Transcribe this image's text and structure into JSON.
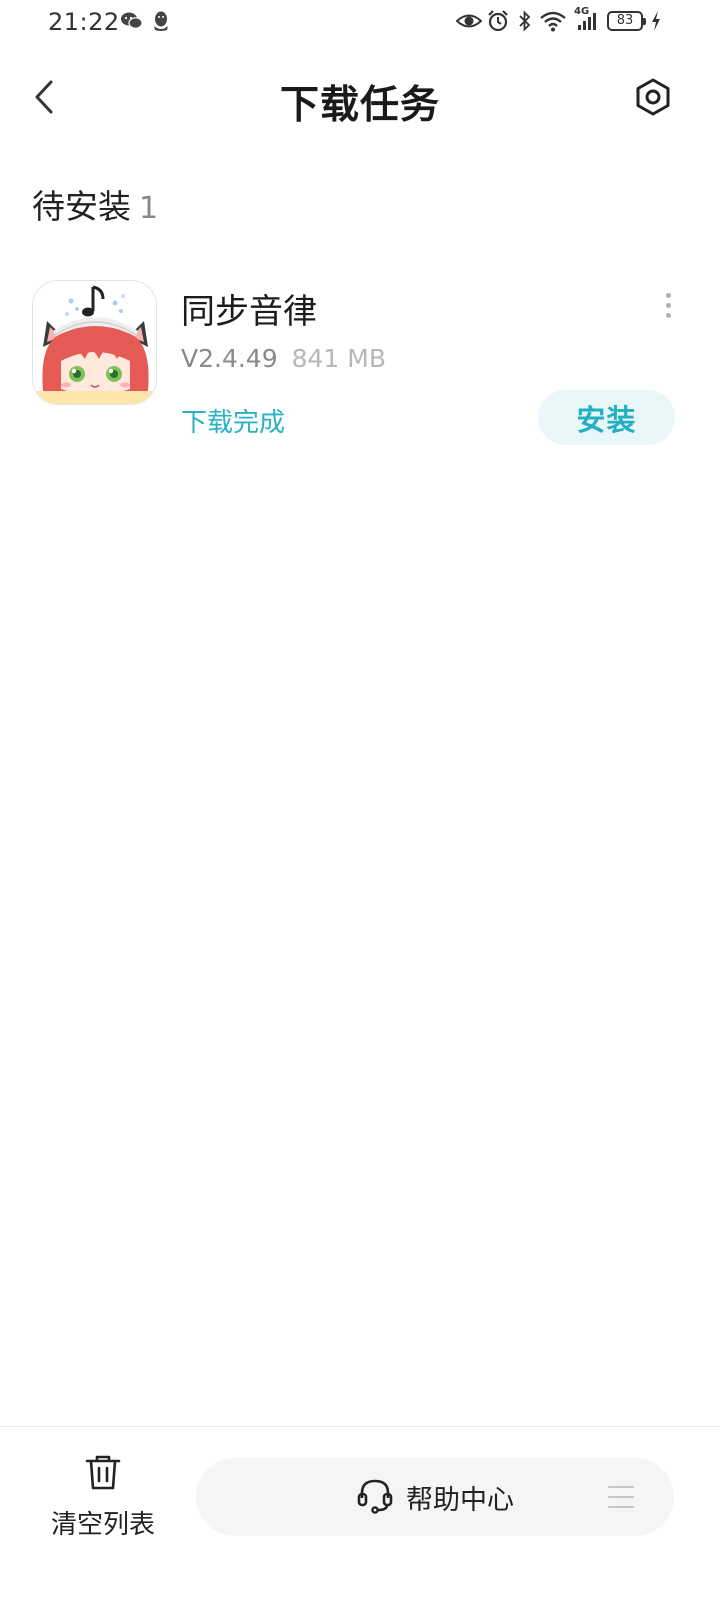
{
  "status_bar": {
    "time": "21:22",
    "network": "4G",
    "battery": "83"
  },
  "header": {
    "title": "下载任务"
  },
  "section": {
    "title": "待安装",
    "count": "1"
  },
  "task": {
    "app_name": "同步音律",
    "version": "V2.4.49",
    "size": "841 MB",
    "status": "下载完成",
    "install_label": "安装"
  },
  "bottom": {
    "clear_label": "清空列表",
    "help_label": "帮助中心"
  },
  "colors": {
    "accent": "#21b0c1",
    "install_bg": "#e9f7f9"
  }
}
